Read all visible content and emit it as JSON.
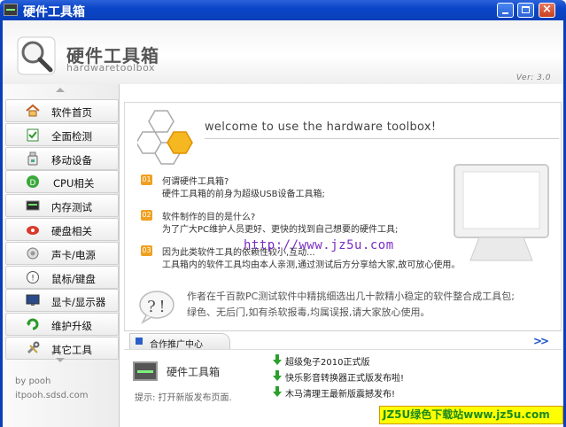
{
  "window": {
    "title": "硬件工具箱",
    "controls": [
      "minimize",
      "maximize",
      "close"
    ]
  },
  "header": {
    "title": "硬件工具箱",
    "subtitle": "hardwaretoolbox",
    "version": "Ver: 3.0",
    "logo_icon": "magnifier-icon"
  },
  "sidebar": {
    "items": [
      {
        "label": "软件首页",
        "icon": "house-icon"
      },
      {
        "label": "全面检测",
        "icon": "clipboard-check-icon"
      },
      {
        "label": "移动设备",
        "icon": "usb-drive-icon"
      },
      {
        "label": "CPU相关",
        "icon": "cpu-icon"
      },
      {
        "label": "内存测试",
        "icon": "memory-icon"
      },
      {
        "label": "硬盘相关",
        "icon": "hard-disk-icon"
      },
      {
        "label": "声卡/电源",
        "icon": "speaker-icon"
      },
      {
        "label": "鼠标/键盘",
        "icon": "mouse-icon"
      },
      {
        "label": "显卡/显示器",
        "icon": "display-icon"
      },
      {
        "label": "维护升级",
        "icon": "refresh-icon"
      },
      {
        "label": "其它工具",
        "icon": "tools-icon"
      }
    ],
    "credit_line1": "by pooh",
    "credit_line2": "itpooh.sdsd.com"
  },
  "main": {
    "welcome": "welcome to use the hardware toolbox!",
    "qa": [
      {
        "num": "01",
        "q": "何谓硬件工具箱?",
        "a": "硬件工具箱的前身为超级USB设备工具箱;"
      },
      {
        "num": "02",
        "q": "软件制作的目的是什么?",
        "a": "为了广大PC维护人员更好、更快的找到自己想要的硬件工具;"
      },
      {
        "num": "03",
        "q": "因为此类软件工具的依赖性较小,互动...",
        "a": "工具箱内的软件工具均由本人亲测,通过测试后方分享给大家,故可放心使用。"
      }
    ],
    "url": "http://www.jz5u.com",
    "quote_line1": "作者在千百款PC测试软件中精挑细选出几十款精小稳定的软件整合成工具包;",
    "quote_line2": "绿色、无后门,如有杀软报毒,均属误报,请大家放心使用。"
  },
  "partner": {
    "tab_label": "合作推广中心",
    "more": ">>",
    "app_name": "硬件工具箱",
    "hint": "提示: 打开新版发布页面.",
    "news": [
      "超级兔子2010正式版",
      "快乐影音转换器正式版发布啦!",
      "木马清理王最新版震撼发布!"
    ]
  },
  "watermark": "JZ5U绿色下载站www.jz5u.com",
  "colors": {
    "titlebar": "#0b46c8",
    "accent_orange": "#f0a020",
    "url_purple": "#7a2cc4",
    "watermark_bg": "#ffff00",
    "watermark_text": "#1c8a1c"
  }
}
